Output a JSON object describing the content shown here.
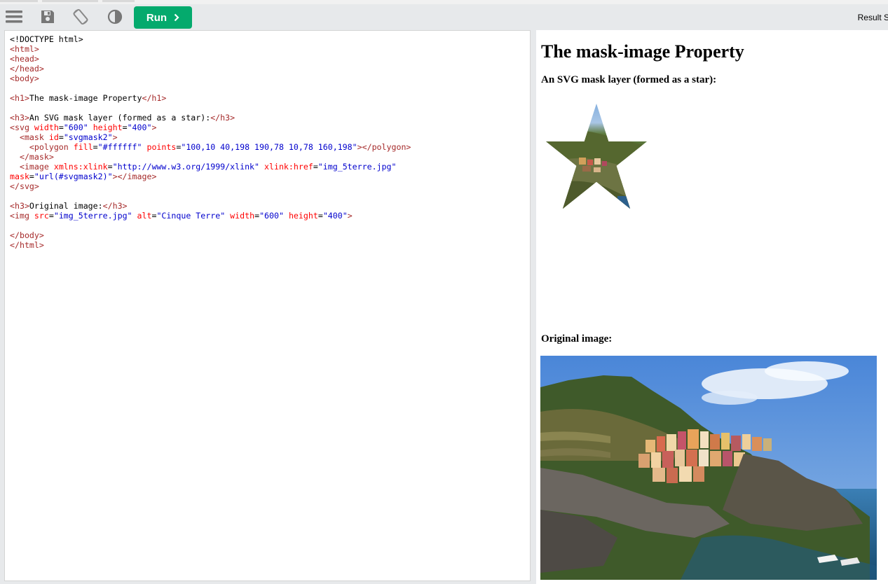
{
  "toolbar": {
    "run_label": "Run",
    "result_label": "Result S",
    "icons": [
      "menu-icon",
      "save-icon",
      "rotate-icon",
      "contrast-icon",
      "chevron-right-icon"
    ]
  },
  "editor": {
    "l1": "<!DOCTYPE html>",
    "l2": "<html>",
    "l3": "<head>",
    "l4": "</head>",
    "l5": "<body>",
    "h1_open": "<h1>",
    "h1_text": "The mask-image Property",
    "h1_close": "</h1>",
    "h3a_open": "<h3>",
    "h3a_text": "An SVG mask layer (formed as a star):",
    "h3a_close": "</h3>",
    "svg_tag": "<svg",
    "svg_a1": "width",
    "svg_v1": "\"600\"",
    "svg_a2": "height",
    "svg_v2": "\"400\"",
    "mask_tag": "<mask",
    "mask_a1": "id",
    "mask_v1": "\"svgmask2\"",
    "poly_tag": "<polygon",
    "poly_a1": "fill",
    "poly_v1": "\"#ffffff\"",
    "poly_a2": "points",
    "poly_v2": "\"100,10 40,198 190,78 10,78 160,198\"",
    "poly_close": "</polygon>",
    "mask_close": "</mask>",
    "image_tag": "<image",
    "image_a1": "xmlns:xlink",
    "image_v1": "\"http://www.w3.org/1999/xlink\"",
    "image_a2": "xlink:href",
    "image_v2": "\"img_5terre.jpg\"",
    "image_a3": "mask",
    "image_v3": "\"url(#svgmask2)\"",
    "image_close": "</image>",
    "svg_close": "</svg>",
    "h3b_open": "<h3>",
    "h3b_text": "Original image:",
    "h3b_close": "</h3>",
    "img_tag": "<img",
    "img_a1": "src",
    "img_v1": "\"img_5terre.jpg\"",
    "img_a2": "alt",
    "img_v2": "\"Cinque Terre\"",
    "img_a3": "width",
    "img_v3": "\"600\"",
    "img_a4": "height",
    "img_v4": "\"400\"",
    "body_close": "</body>",
    "html_close": "</html>"
  },
  "result": {
    "title": "The mask-image Property",
    "subtitle": "An SVG mask layer (formed as a star):",
    "original_label": "Original image:"
  },
  "colors": {
    "run_green": "#04aa6d",
    "tag": "#a52a2a",
    "tag_bracket": "#0000cd",
    "attribute": "#ff0000",
    "value": "#0000cd"
  }
}
